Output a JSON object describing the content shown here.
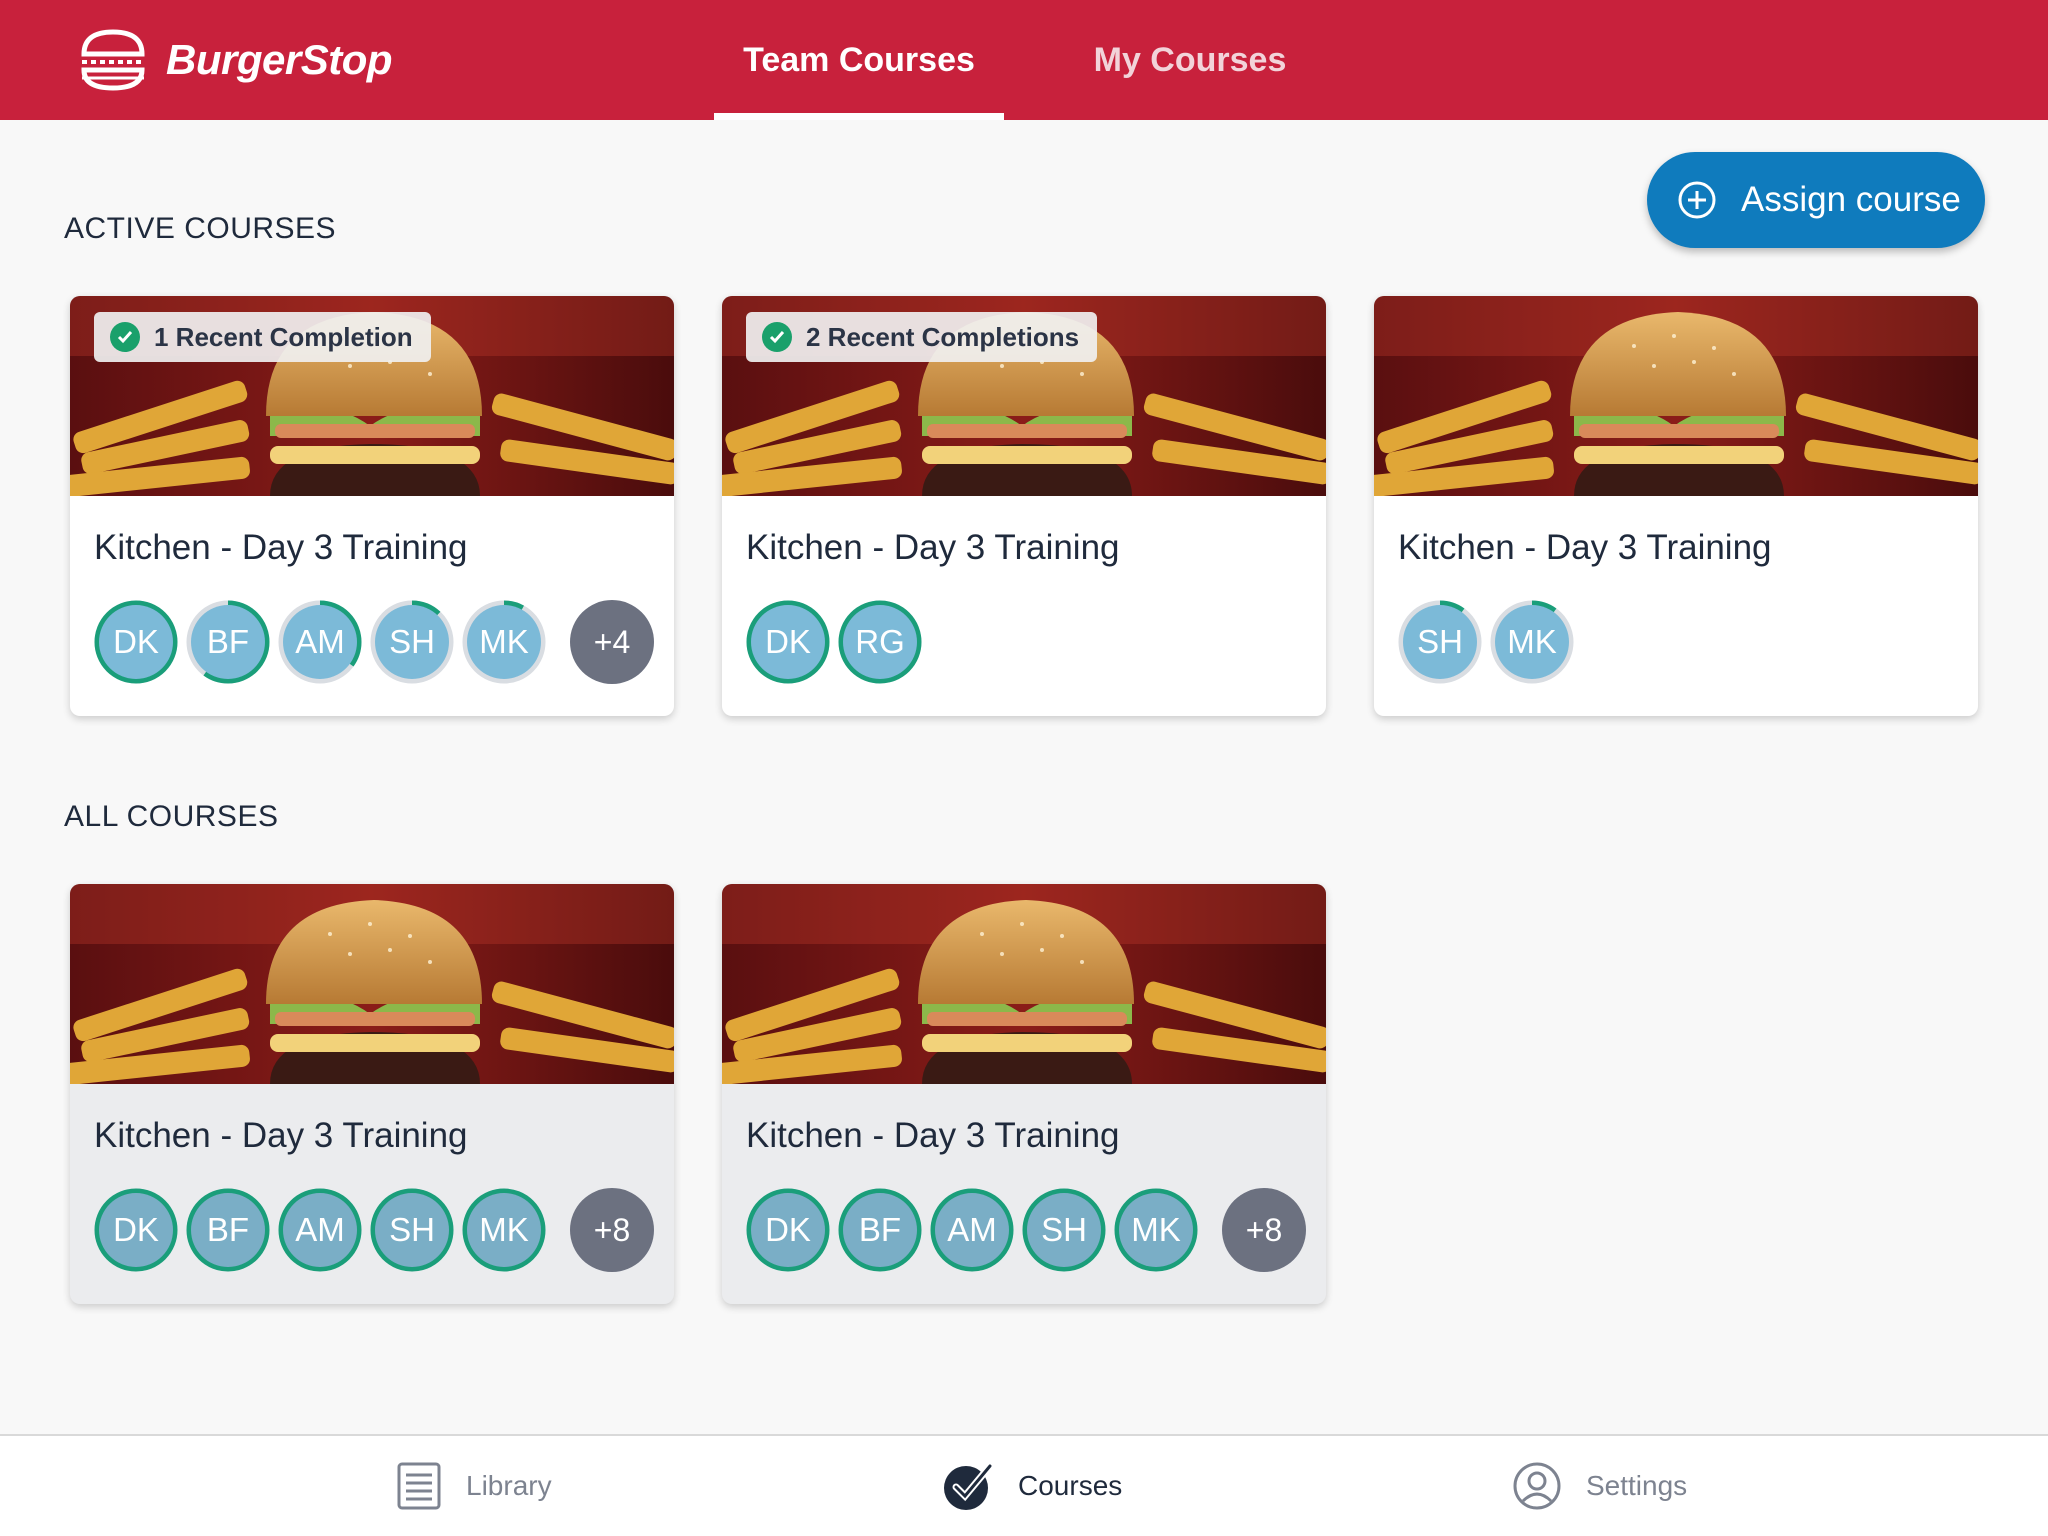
{
  "brand": {
    "name": "BurgerStop",
    "header_color": "#c8213c"
  },
  "tabs": [
    {
      "label": "Team Courses",
      "active": true
    },
    {
      "label": "My Courses",
      "active": false
    }
  ],
  "actions": {
    "assign_label": "Assign course",
    "assign_color": "#0f7bbd"
  },
  "sections": {
    "active_title": "ACTIVE COURSES",
    "all_title": "ALL COURSES"
  },
  "active_courses": [
    {
      "badge": "1 Recent Completion",
      "title": "Kitchen - Day 3 Training",
      "members": [
        {
          "initials": "DK",
          "progress": 1.0
        },
        {
          "initials": "BF",
          "progress": 0.6
        },
        {
          "initials": "AM",
          "progress": 0.35
        },
        {
          "initials": "SH",
          "progress": 0.12
        },
        {
          "initials": "MK",
          "progress": 0.08
        }
      ],
      "more": "+4"
    },
    {
      "badge": "2 Recent Completions",
      "title": "Kitchen - Day 3 Training",
      "members": [
        {
          "initials": "DK",
          "progress": 1.0
        },
        {
          "initials": "RG",
          "progress": 1.0
        }
      ],
      "more": ""
    },
    {
      "badge": "",
      "title": "Kitchen - Day 3 Training",
      "members": [
        {
          "initials": "SH",
          "progress": 0.1
        },
        {
          "initials": "MK",
          "progress": 0.1
        }
      ],
      "more": ""
    }
  ],
  "all_courses": [
    {
      "title": "Kitchen - Day 3 Training",
      "members": [
        {
          "initials": "DK",
          "progress": 1.0
        },
        {
          "initials": "BF",
          "progress": 1.0
        },
        {
          "initials": "AM",
          "progress": 1.0
        },
        {
          "initials": "SH",
          "progress": 1.0
        },
        {
          "initials": "MK",
          "progress": 1.0
        }
      ],
      "more": "+8"
    },
    {
      "title": "Kitchen - Day 3 Training",
      "members": [
        {
          "initials": "DK",
          "progress": 1.0
        },
        {
          "initials": "BF",
          "progress": 1.0
        },
        {
          "initials": "AM",
          "progress": 1.0
        },
        {
          "initials": "SH",
          "progress": 1.0
        },
        {
          "initials": "MK",
          "progress": 1.0
        }
      ],
      "more": "+8"
    }
  ],
  "bottom_nav": [
    {
      "label": "Library",
      "icon": "library-icon",
      "active": false
    },
    {
      "label": "Courses",
      "icon": "check-circle-icon",
      "active": true
    },
    {
      "label": "Settings",
      "icon": "user-circle-icon",
      "active": false
    }
  ],
  "colors": {
    "progress_ring": "#1a9e7a",
    "avatar_fill": "#7cbad8",
    "more_fill": "#6c7180"
  }
}
